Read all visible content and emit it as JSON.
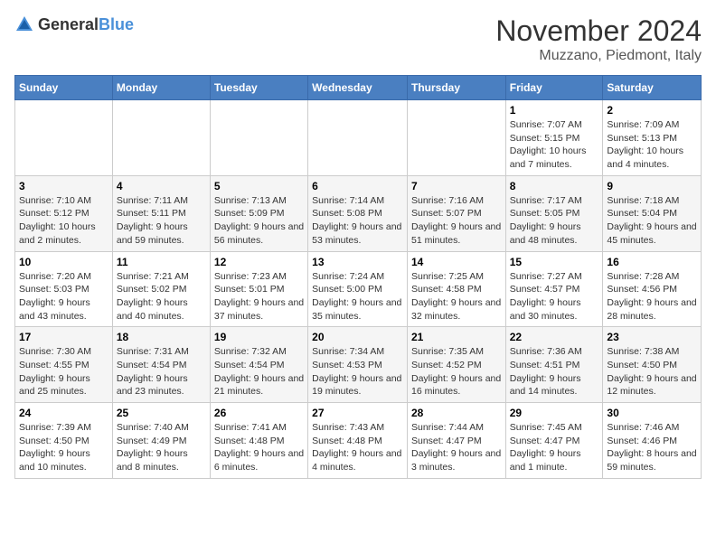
{
  "header": {
    "logo_general": "General",
    "logo_blue": "Blue",
    "month_year": "November 2024",
    "location": "Muzzano, Piedmont, Italy"
  },
  "weekdays": [
    "Sunday",
    "Monday",
    "Tuesday",
    "Wednesday",
    "Thursday",
    "Friday",
    "Saturday"
  ],
  "weeks": [
    [
      {
        "day": "",
        "info": ""
      },
      {
        "day": "",
        "info": ""
      },
      {
        "day": "",
        "info": ""
      },
      {
        "day": "",
        "info": ""
      },
      {
        "day": "",
        "info": ""
      },
      {
        "day": "1",
        "info": "Sunrise: 7:07 AM\nSunset: 5:15 PM\nDaylight: 10 hours and 7 minutes."
      },
      {
        "day": "2",
        "info": "Sunrise: 7:09 AM\nSunset: 5:13 PM\nDaylight: 10 hours and 4 minutes."
      }
    ],
    [
      {
        "day": "3",
        "info": "Sunrise: 7:10 AM\nSunset: 5:12 PM\nDaylight: 10 hours and 2 minutes."
      },
      {
        "day": "4",
        "info": "Sunrise: 7:11 AM\nSunset: 5:11 PM\nDaylight: 9 hours and 59 minutes."
      },
      {
        "day": "5",
        "info": "Sunrise: 7:13 AM\nSunset: 5:09 PM\nDaylight: 9 hours and 56 minutes."
      },
      {
        "day": "6",
        "info": "Sunrise: 7:14 AM\nSunset: 5:08 PM\nDaylight: 9 hours and 53 minutes."
      },
      {
        "day": "7",
        "info": "Sunrise: 7:16 AM\nSunset: 5:07 PM\nDaylight: 9 hours and 51 minutes."
      },
      {
        "day": "8",
        "info": "Sunrise: 7:17 AM\nSunset: 5:05 PM\nDaylight: 9 hours and 48 minutes."
      },
      {
        "day": "9",
        "info": "Sunrise: 7:18 AM\nSunset: 5:04 PM\nDaylight: 9 hours and 45 minutes."
      }
    ],
    [
      {
        "day": "10",
        "info": "Sunrise: 7:20 AM\nSunset: 5:03 PM\nDaylight: 9 hours and 43 minutes."
      },
      {
        "day": "11",
        "info": "Sunrise: 7:21 AM\nSunset: 5:02 PM\nDaylight: 9 hours and 40 minutes."
      },
      {
        "day": "12",
        "info": "Sunrise: 7:23 AM\nSunset: 5:01 PM\nDaylight: 9 hours and 37 minutes."
      },
      {
        "day": "13",
        "info": "Sunrise: 7:24 AM\nSunset: 5:00 PM\nDaylight: 9 hours and 35 minutes."
      },
      {
        "day": "14",
        "info": "Sunrise: 7:25 AM\nSunset: 4:58 PM\nDaylight: 9 hours and 32 minutes."
      },
      {
        "day": "15",
        "info": "Sunrise: 7:27 AM\nSunset: 4:57 PM\nDaylight: 9 hours and 30 minutes."
      },
      {
        "day": "16",
        "info": "Sunrise: 7:28 AM\nSunset: 4:56 PM\nDaylight: 9 hours and 28 minutes."
      }
    ],
    [
      {
        "day": "17",
        "info": "Sunrise: 7:30 AM\nSunset: 4:55 PM\nDaylight: 9 hours and 25 minutes."
      },
      {
        "day": "18",
        "info": "Sunrise: 7:31 AM\nSunset: 4:54 PM\nDaylight: 9 hours and 23 minutes."
      },
      {
        "day": "19",
        "info": "Sunrise: 7:32 AM\nSunset: 4:54 PM\nDaylight: 9 hours and 21 minutes."
      },
      {
        "day": "20",
        "info": "Sunrise: 7:34 AM\nSunset: 4:53 PM\nDaylight: 9 hours and 19 minutes."
      },
      {
        "day": "21",
        "info": "Sunrise: 7:35 AM\nSunset: 4:52 PM\nDaylight: 9 hours and 16 minutes."
      },
      {
        "day": "22",
        "info": "Sunrise: 7:36 AM\nSunset: 4:51 PM\nDaylight: 9 hours and 14 minutes."
      },
      {
        "day": "23",
        "info": "Sunrise: 7:38 AM\nSunset: 4:50 PM\nDaylight: 9 hours and 12 minutes."
      }
    ],
    [
      {
        "day": "24",
        "info": "Sunrise: 7:39 AM\nSunset: 4:50 PM\nDaylight: 9 hours and 10 minutes."
      },
      {
        "day": "25",
        "info": "Sunrise: 7:40 AM\nSunset: 4:49 PM\nDaylight: 9 hours and 8 minutes."
      },
      {
        "day": "26",
        "info": "Sunrise: 7:41 AM\nSunset: 4:48 PM\nDaylight: 9 hours and 6 minutes."
      },
      {
        "day": "27",
        "info": "Sunrise: 7:43 AM\nSunset: 4:48 PM\nDaylight: 9 hours and 4 minutes."
      },
      {
        "day": "28",
        "info": "Sunrise: 7:44 AM\nSunset: 4:47 PM\nDaylight: 9 hours and 3 minutes."
      },
      {
        "day": "29",
        "info": "Sunrise: 7:45 AM\nSunset: 4:47 PM\nDaylight: 9 hours and 1 minute."
      },
      {
        "day": "30",
        "info": "Sunrise: 7:46 AM\nSunset: 4:46 PM\nDaylight: 8 hours and 59 minutes."
      }
    ]
  ]
}
